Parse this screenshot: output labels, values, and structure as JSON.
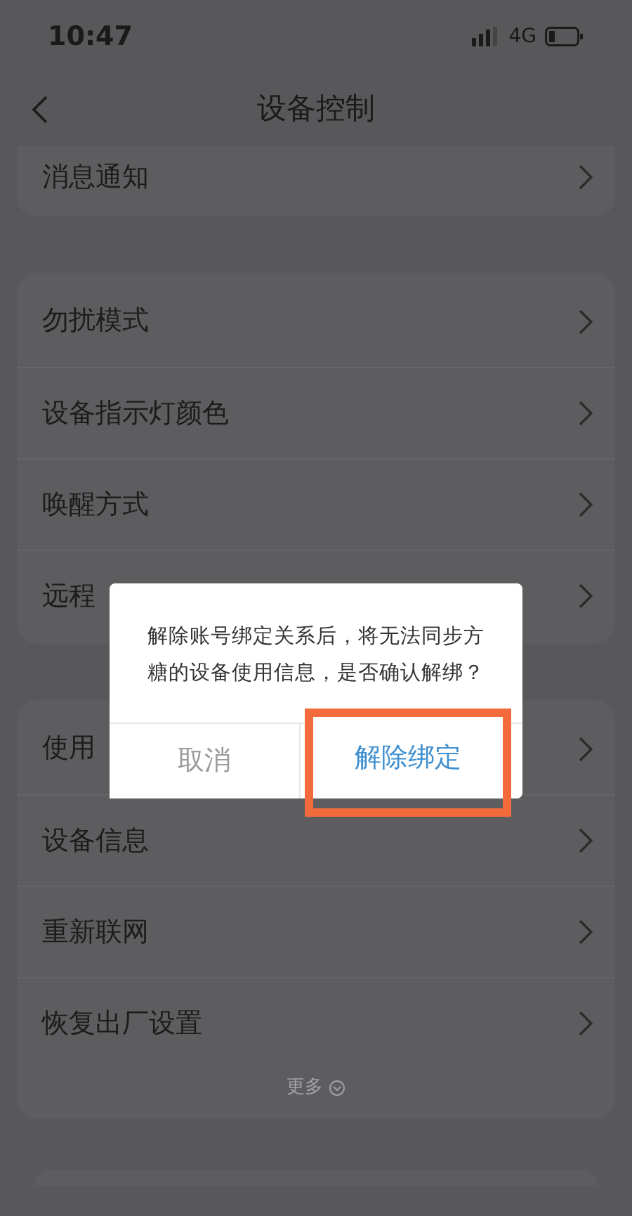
{
  "status_bar": {
    "time": "10:47",
    "network": "4G"
  },
  "nav": {
    "title": "设备控制"
  },
  "groups": [
    {
      "items": [
        {
          "label": "消息通知"
        }
      ]
    },
    {
      "items": [
        {
          "label": "勿扰模式"
        },
        {
          "label": "设备指示灯颜色"
        },
        {
          "label": "唤醒方式"
        },
        {
          "label": "远程"
        }
      ]
    },
    {
      "items": [
        {
          "label": "使用"
        },
        {
          "label": "设备信息"
        },
        {
          "label": "重新联网"
        },
        {
          "label": "恢复出厂设置"
        }
      ],
      "more": "更多"
    }
  ],
  "dialog": {
    "message": "解除账号绑定关系后，将无法同步方糖的设备使用信息，是否确认解绑？",
    "buttons": [
      {
        "label": "取消",
        "kind": "cancel",
        "highlighted": false
      },
      {
        "label": "解除绑定",
        "kind": "confirm",
        "highlighted": true
      }
    ]
  }
}
